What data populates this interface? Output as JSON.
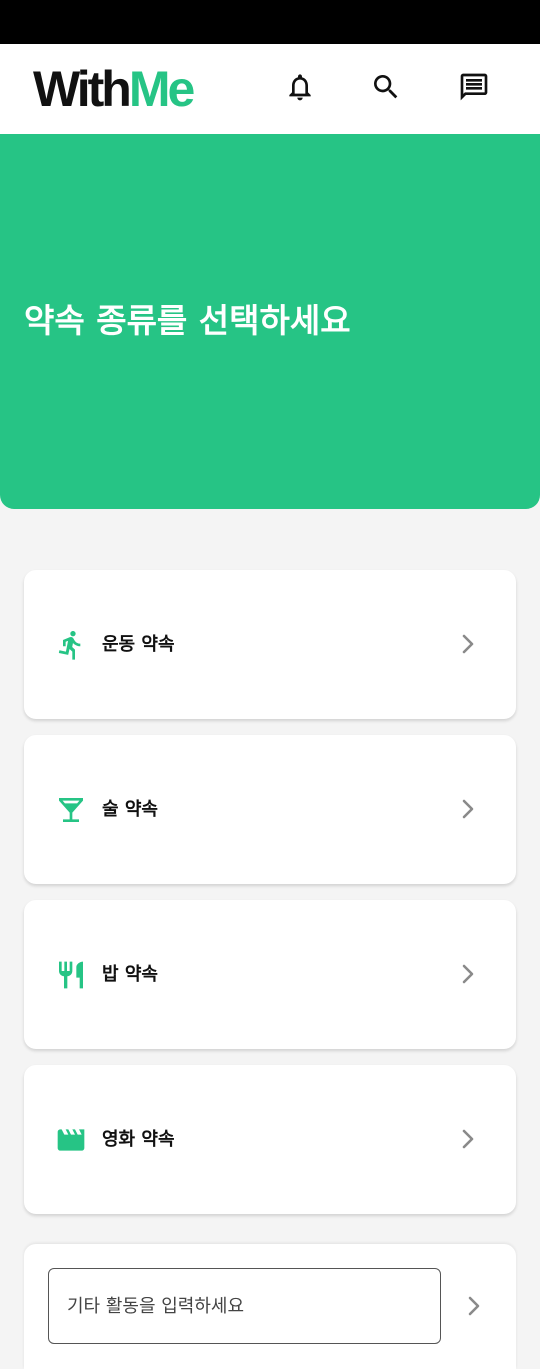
{
  "header": {
    "logo_part1": "With",
    "logo_part2": "Me",
    "icons": [
      "bell-icon",
      "search-icon",
      "chat-icon"
    ]
  },
  "hero": {
    "title": "약속 종류를 선택하세요"
  },
  "categories": [
    {
      "label": "운동 약속",
      "icon": "running-icon"
    },
    {
      "label": "술 약속",
      "icon": "cocktail-icon"
    },
    {
      "label": "밥 약속",
      "icon": "restaurant-icon"
    },
    {
      "label": "영화 약속",
      "icon": "movie-clapper-icon"
    }
  ],
  "other": {
    "placeholder": "기타 활동을 입력하세요",
    "value": ""
  },
  "colors": {
    "accent": "#26c485",
    "status_bar": "#000000",
    "background": "#f4f4f4",
    "chevron": "#8a8a8a"
  }
}
